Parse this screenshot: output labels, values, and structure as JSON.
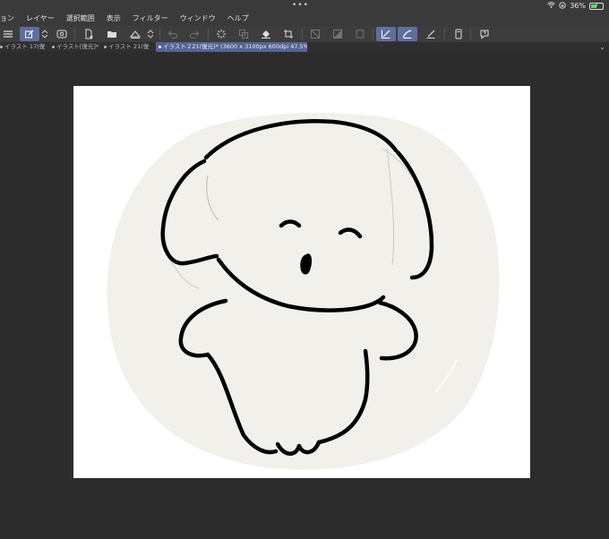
{
  "status_bar": {
    "dots": "•••",
    "battery_text": "36%"
  },
  "menu": {
    "items": [
      "ョン",
      "レイヤー",
      "選択範囲",
      "表示",
      "フィルター",
      "ウィンドウ",
      "ヘルプ"
    ]
  },
  "toolbar": {
    "icons": [
      "menu-icon",
      "layer-property-icon",
      "chevron-updown-icon",
      "preview-icon",
      "new-file-icon",
      "open-folder-icon",
      "save-icon",
      "chevron-updown-icon",
      "undo-icon",
      "redo-icon",
      "loading-icon",
      "copy-icon",
      "fill-icon",
      "crop-icon",
      "deselect-icon",
      "invert-selection-icon",
      "selection-border-icon",
      "stabilize-pen-icon",
      "smooth-line-icon",
      "ruler-pen-icon",
      "device-icon",
      "help-icon"
    ]
  },
  "tabs": [
    {
      "label": "イラスト 17(復",
      "active": false
    },
    {
      "label": "イラスト[復元]*",
      "active": false
    },
    {
      "label": "イラスト 21(復",
      "active": false
    },
    {
      "label": "イラスト２21(復元)* (3600 x 3100px 600dpi 47.5%)",
      "active": true
    }
  ],
  "colors": {
    "ui_dark": "#2c2c2c",
    "menu_bg": "#3a3a3a",
    "accent": "#5f6f9c",
    "paper": "#f2f0ea",
    "ink": "#000000"
  }
}
